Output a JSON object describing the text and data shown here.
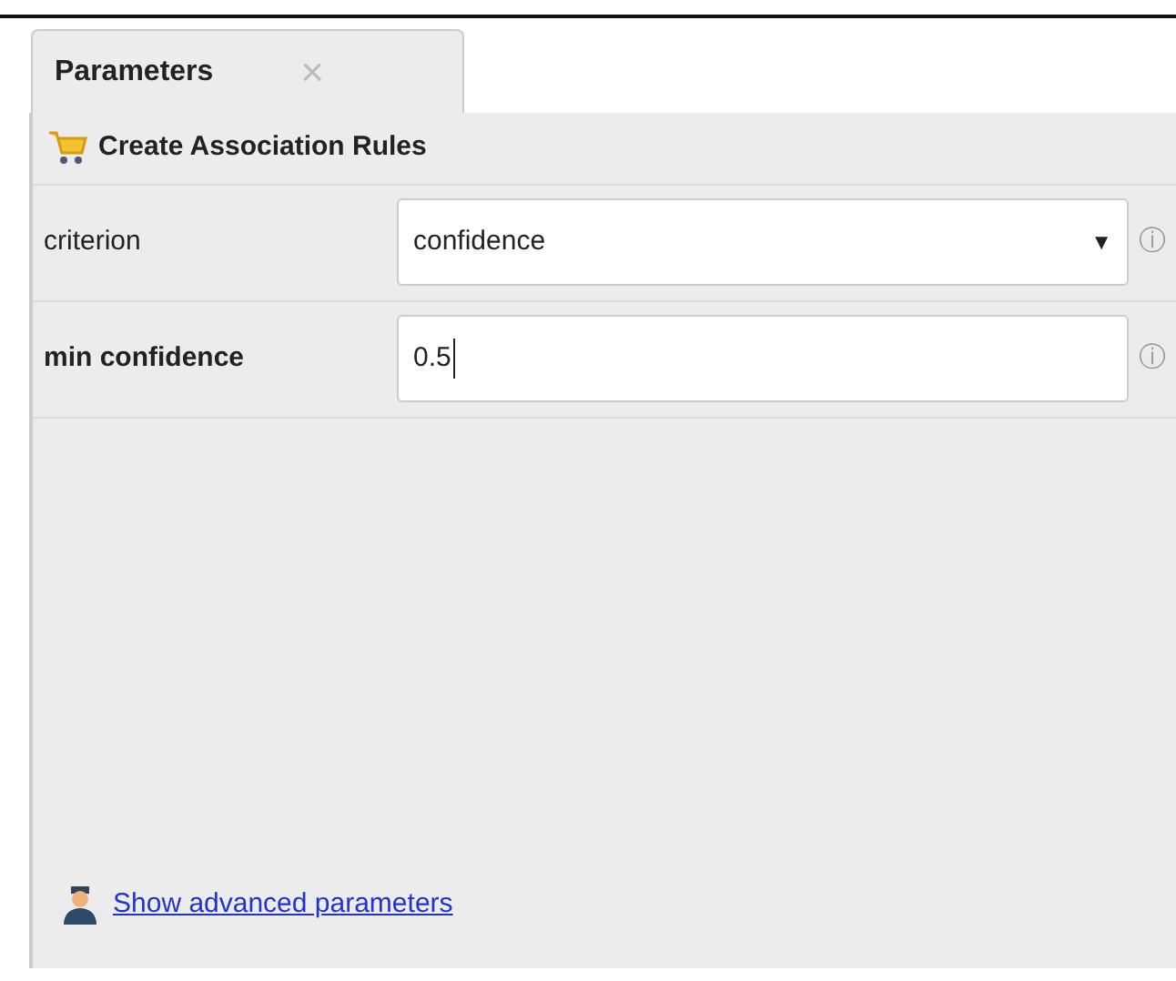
{
  "tab": {
    "label": "Parameters",
    "close": "×"
  },
  "operator": {
    "title": "Create Association Rules"
  },
  "parameters": [
    {
      "kind": "select",
      "label": "criterion",
      "emphasized": false,
      "value": "confidence",
      "caret": "▼",
      "info": "ⓘ"
    },
    {
      "kind": "text",
      "label": "min confidence",
      "emphasized": true,
      "value": "0.5",
      "info": "ⓘ"
    }
  ],
  "advanced_link": "Show advanced parameters"
}
